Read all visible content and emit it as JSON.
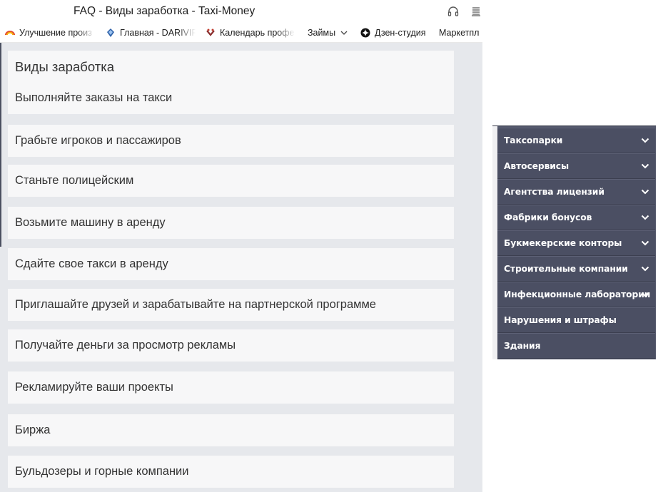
{
  "window": {
    "title": "FAQ - Виды заработка - Taxi-Money"
  },
  "toolbar_icons": [
    "headphones-icon",
    "reader-mode-icon"
  ],
  "bookmarks": [
    {
      "label": "Улучшение произ",
      "icon": "rainbow-icon"
    },
    {
      "label": "Главная - DARIVIP",
      "icon": "darivip-icon"
    },
    {
      "label": "Календарь профе",
      "icon": "calendar-site-icon"
    },
    {
      "label": "Займы",
      "icon": "chevron-down-icon"
    },
    {
      "label": "Дзен-студия",
      "icon": "zen-icon"
    },
    {
      "label": "Маркетпл",
      "icon": ""
    }
  ],
  "faq": {
    "heading": "Виды заработка",
    "items": [
      "Выполняйте заказы на такси",
      "Грабьте игроков и пассажиров",
      "Станьте полицейским",
      "Возьмите машину в аренду",
      "Сдайте свое такси в аренду",
      "Приглашайте друзей и зарабатывайте на партнерской программе",
      "Получайте деньги за просмотр рекламы",
      "Рекламируйте ваши проекты",
      "Биржа",
      "Бульдозеры и горные компании"
    ]
  },
  "side_menu": {
    "items": [
      {
        "label": "Таксопарки",
        "has_chevron": true
      },
      {
        "label": "Автосервисы",
        "has_chevron": true
      },
      {
        "label": "Агентства лицензий",
        "has_chevron": true
      },
      {
        "label": "Фабрики бонусов",
        "has_chevron": true
      },
      {
        "label": "Букмекерские конторы",
        "has_chevron": true
      },
      {
        "label": "Строительные компании",
        "has_chevron": true
      },
      {
        "label": "Инфекционные лаборатории",
        "has_chevron": true
      },
      {
        "label": "Нарушения и штрафы",
        "has_chevron": false
      },
      {
        "label": "Здания",
        "has_chevron": false
      }
    ]
  },
  "colors": {
    "page_bg": "#e6e8ec",
    "card_bg": "#f7f7f8",
    "menu_bg": "#4b4f63",
    "menu_text": "#ffffff"
  }
}
